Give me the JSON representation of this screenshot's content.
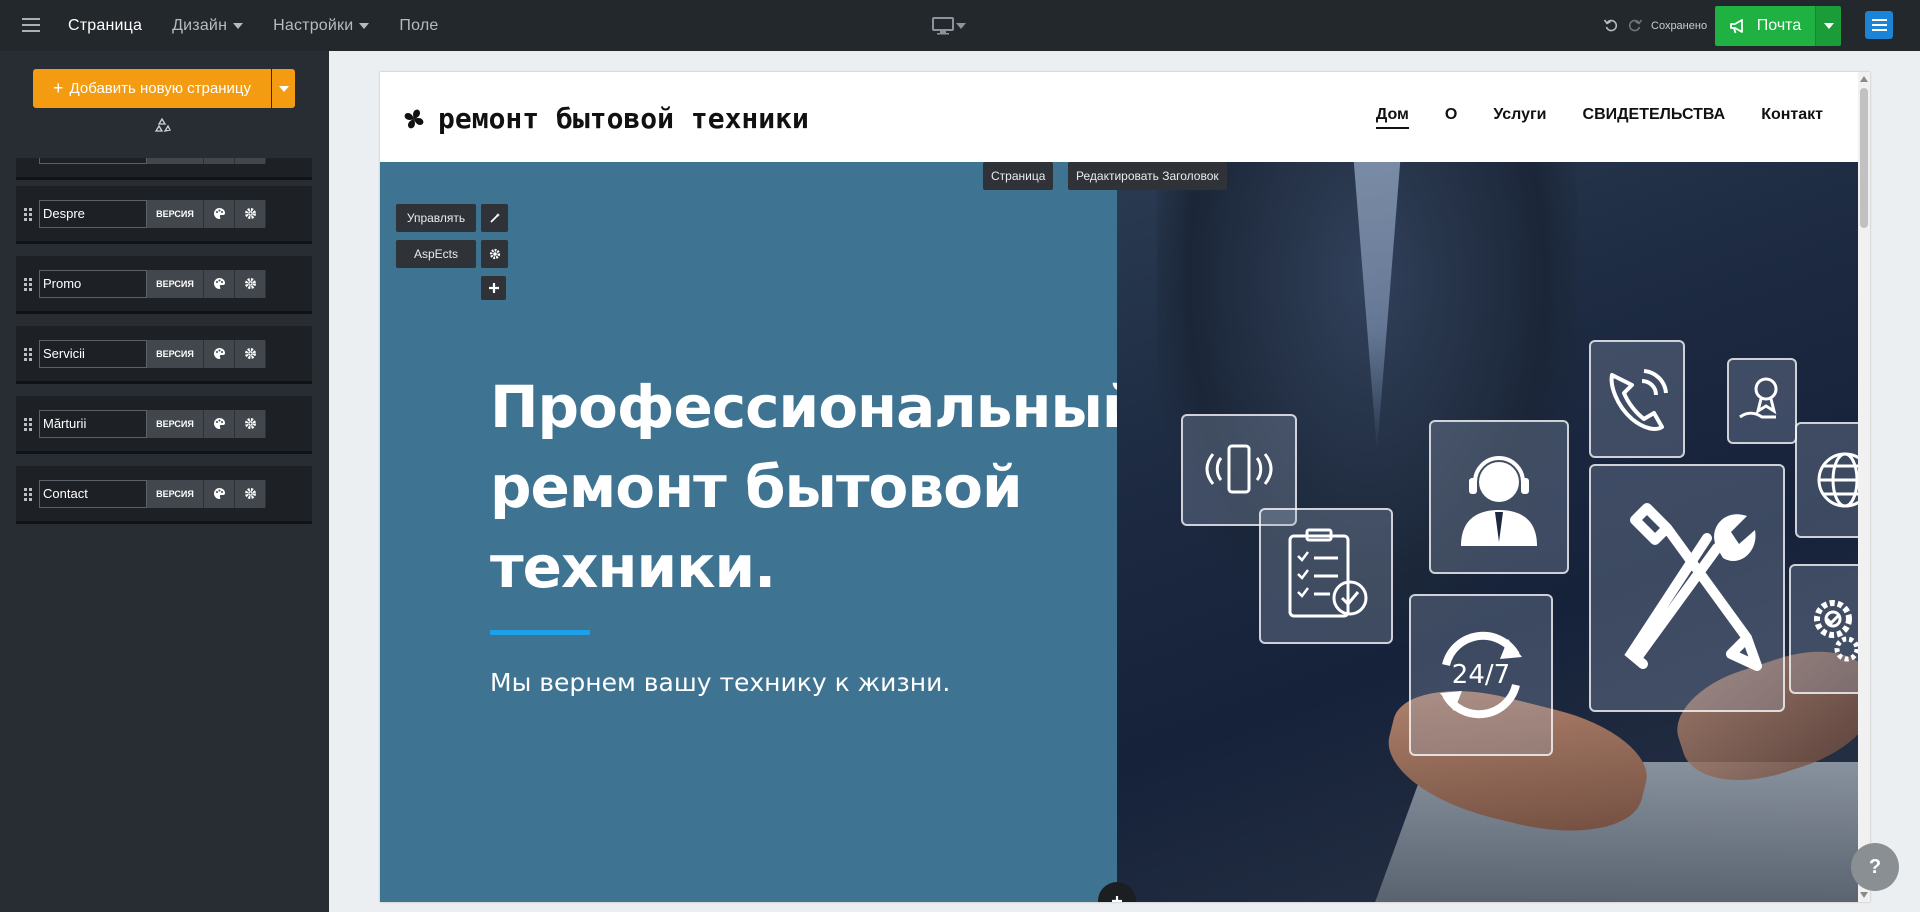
{
  "topbar": {
    "nav": [
      "Страница",
      "Дизайн",
      "Настройки",
      "Поле"
    ],
    "saved_status": "Сохранено",
    "publish_label": "Почта"
  },
  "sidebar": {
    "add_page_label": "Добавить новую страницу",
    "version_label": "ВЕРСИЯ",
    "pages": [
      "Despre",
      "Promo",
      "Servicii",
      "Mărturii",
      "Contact"
    ]
  },
  "site": {
    "logo_text": "ремонт бытовой техники",
    "nav": [
      "Дом",
      "О",
      "Услуги",
      "СВИДЕТЕЛЬСТВА",
      "Контакт"
    ],
    "hero_title_lines": [
      "Профессиональный",
      "ремонт бытовой",
      "техники."
    ],
    "hero_subtitle": "Мы вернем вашу технику к жизни."
  },
  "editor": {
    "page_chip": "Страница",
    "edit_header_chip": "Редактировать Заголовок",
    "manage_chip": "Управлять",
    "aspects_chip": "AspEcts"
  },
  "tiles": {
    "hours_label": "24/7"
  },
  "help": "?"
}
